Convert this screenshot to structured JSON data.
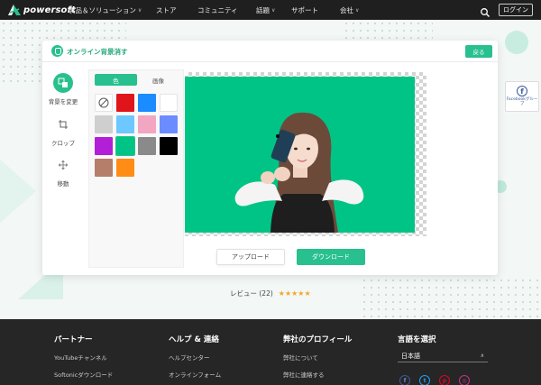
{
  "nav": {
    "brand": "powersoft",
    "items": [
      {
        "label": "製品＆ソリューション",
        "dropdown": true
      },
      {
        "label": "ストア",
        "dropdown": false
      },
      {
        "label": "コミュニティ",
        "dropdown": false
      },
      {
        "label": "話題",
        "dropdown": true
      },
      {
        "label": "サポート",
        "dropdown": false
      },
      {
        "label": "会社",
        "dropdown": true
      }
    ],
    "login": "ログイン"
  },
  "editor": {
    "title": "オンライン背景消す",
    "back": "戻る",
    "tools": [
      {
        "label": "背景を変更",
        "icon": "background-change-icon",
        "active": true
      },
      {
        "label": "クロップ",
        "icon": "crop-icon",
        "active": false
      },
      {
        "label": "移動",
        "icon": "move-icon",
        "active": false
      }
    ],
    "tabs": {
      "color": "色",
      "image": "画像"
    },
    "swatches": [
      {
        "name": "none",
        "color": "#ffffff"
      },
      {
        "name": "red",
        "color": "#e0151b"
      },
      {
        "name": "blue",
        "color": "#1a8cff"
      },
      {
        "name": "white",
        "color": "#ffffff"
      },
      {
        "name": "light-gray",
        "color": "#cfcfcf"
      },
      {
        "name": "sky-blue",
        "color": "#6cc8ff"
      },
      {
        "name": "pink",
        "color": "#f2a6c2"
      },
      {
        "name": "periwinkle",
        "color": "#6b8cff"
      },
      {
        "name": "purple",
        "color": "#b21fd6"
      },
      {
        "name": "green",
        "color": "#00c485"
      },
      {
        "name": "gray",
        "color": "#8a8a8a"
      },
      {
        "name": "black",
        "color": "#000000"
      },
      {
        "name": "tan",
        "color": "#b57e6a"
      },
      {
        "name": "orange",
        "color": "#ff8c14"
      }
    ],
    "selected_swatch": "green",
    "upload": "アップロード",
    "download": "ダウンロード"
  },
  "facebook": {
    "label": "Facebookグループ"
  },
  "review": {
    "text": "レビュー (22)",
    "stars": "★★★★★"
  },
  "footer": {
    "partner": {
      "title": "パートナー",
      "links": [
        "YouTubeチャンネル",
        "Softonicダウンロード"
      ]
    },
    "help": {
      "title": "ヘルプ & 連絡",
      "links": [
        "ヘルプセンター",
        "オンラインフォーム"
      ]
    },
    "company": {
      "title": "弊社のプロフィール",
      "links": [
        "弊社について",
        "弊社に連絡する"
      ]
    },
    "language": {
      "title": "言語を選択",
      "selected": "日本語"
    }
  },
  "colors": {
    "accent": "#28c08e",
    "nav_bg": "#1f1f1f",
    "footer_bg": "#262626"
  }
}
